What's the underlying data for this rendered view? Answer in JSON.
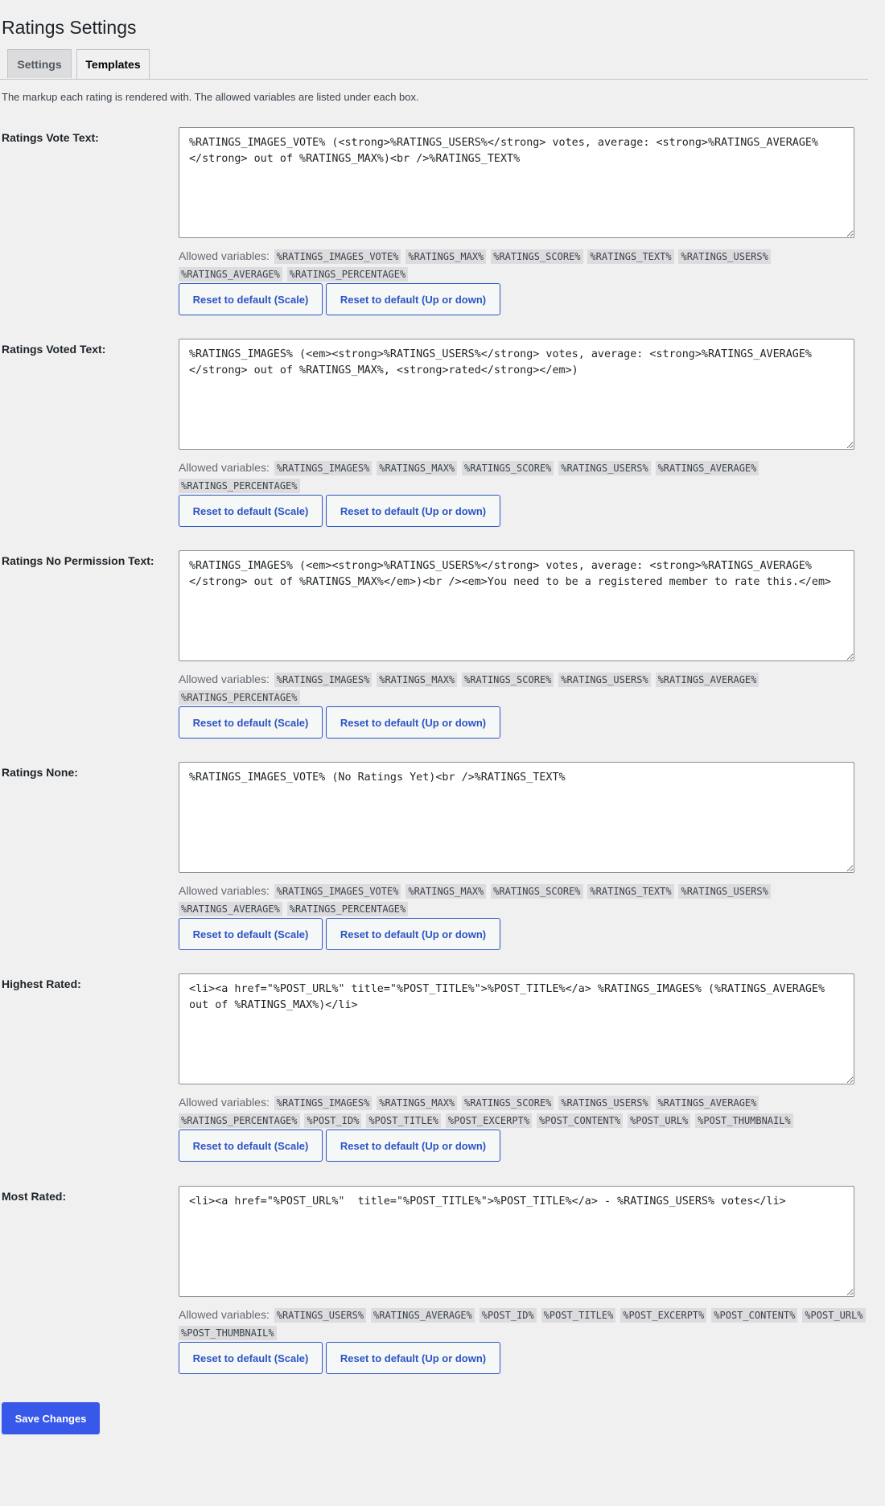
{
  "page": {
    "title": "Ratings Settings"
  },
  "tabs": [
    {
      "label": "Settings",
      "active": false
    },
    {
      "label": "Templates",
      "active": true
    }
  ],
  "intro": "The markup each rating is rendered with. The allowed variables are listed under each box.",
  "allowed_label": "Allowed variables:",
  "reset_scale_label": "Reset to default (Scale)",
  "reset_updown_label": "Reset to default (Up or down)",
  "templates": [
    {
      "label": "Ratings Vote Text:",
      "value": "%RATINGS_IMAGES_VOTE% (<strong>%RATINGS_USERS%</strong> votes, average: <strong>%RATINGS_AVERAGE%</strong> out of %RATINGS_MAX%)<br />%RATINGS_TEXT%",
      "vars": [
        "%RATINGS_IMAGES_VOTE%",
        "%RATINGS_MAX%",
        "%RATINGS_SCORE%",
        "%RATINGS_TEXT%",
        "%RATINGS_USERS%",
        "%RATINGS_AVERAGE%",
        "%RATINGS_PERCENTAGE%"
      ]
    },
    {
      "label": "Ratings Voted Text:",
      "value": "%RATINGS_IMAGES% (<em><strong>%RATINGS_USERS%</strong> votes, average: <strong>%RATINGS_AVERAGE%</strong> out of %RATINGS_MAX%, <strong>rated</strong></em>)",
      "vars": [
        "%RATINGS_IMAGES%",
        "%RATINGS_MAX%",
        "%RATINGS_SCORE%",
        "%RATINGS_USERS%",
        "%RATINGS_AVERAGE%",
        "%RATINGS_PERCENTAGE%"
      ]
    },
    {
      "label": "Ratings No Permission Text:",
      "value": "%RATINGS_IMAGES% (<em><strong>%RATINGS_USERS%</strong> votes, average: <strong>%RATINGS_AVERAGE%</strong> out of %RATINGS_MAX%</em>)<br /><em>You need to be a registered member to rate this.</em>",
      "vars": [
        "%RATINGS_IMAGES%",
        "%RATINGS_MAX%",
        "%RATINGS_SCORE%",
        "%RATINGS_USERS%",
        "%RATINGS_AVERAGE%",
        "%RATINGS_PERCENTAGE%"
      ]
    },
    {
      "label": "Ratings None:",
      "value": "%RATINGS_IMAGES_VOTE% (No Ratings Yet)<br />%RATINGS_TEXT%",
      "vars": [
        "%RATINGS_IMAGES_VOTE%",
        "%RATINGS_MAX%",
        "%RATINGS_SCORE%",
        "%RATINGS_TEXT%",
        "%RATINGS_USERS%",
        "%RATINGS_AVERAGE%",
        "%RATINGS_PERCENTAGE%"
      ]
    },
    {
      "label": "Highest Rated:",
      "value": "<li><a href=\"%POST_URL%\" title=\"%POST_TITLE%\">%POST_TITLE%</a> %RATINGS_IMAGES% (%RATINGS_AVERAGE% out of %RATINGS_MAX%)</li>",
      "vars": [
        "%RATINGS_IMAGES%",
        "%RATINGS_MAX%",
        "%RATINGS_SCORE%",
        "%RATINGS_USERS%",
        "%RATINGS_AVERAGE%",
        "%RATINGS_PERCENTAGE%",
        "%POST_ID%",
        "%POST_TITLE%",
        "%POST_EXCERPT%",
        "%POST_CONTENT%",
        "%POST_URL%",
        "%POST_THUMBNAIL%"
      ]
    },
    {
      "label": "Most Rated:",
      "value": "<li><a href=\"%POST_URL%\"  title=\"%POST_TITLE%\">%POST_TITLE%</a> - %RATINGS_USERS% votes</li>",
      "vars": [
        "%RATINGS_USERS%",
        "%RATINGS_AVERAGE%",
        "%POST_ID%",
        "%POST_TITLE%",
        "%POST_EXCERPT%",
        "%POST_CONTENT%",
        "%POST_URL%",
        "%POST_THUMBNAIL%"
      ]
    }
  ],
  "save_label": "Save Changes",
  "colors": {
    "accent": "#3858e9",
    "link": "#2c55c4",
    "background": "#f0f0f1"
  }
}
